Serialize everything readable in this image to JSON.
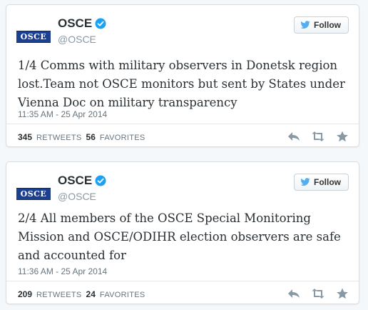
{
  "colors": {
    "verified": "#1da1f2",
    "logo_blue": "#1c3f8f",
    "text": "#292f33",
    "muted": "#8899a6"
  },
  "tweets": [
    {
      "avatar_text": "OSCE",
      "display_name": "OSCE",
      "handle": "@OSCE",
      "follow_label": "Follow",
      "text": "1/4 Comms with military observers in Donetsk region lost.Team not OSCE monitors but sent by States under Vienna Doc on military transparency",
      "timestamp": "11:35 AM - 25 Apr 2014",
      "retweet_count": "345",
      "retweet_label": "RETWEETS",
      "favorite_count": "56",
      "favorite_label": "FAVORITES",
      "icons": [
        "verified-icon",
        "bird-icon",
        "reply-icon",
        "retweet-icon",
        "favorite-icon"
      ]
    },
    {
      "avatar_text": "OSCE",
      "display_name": "OSCE",
      "handle": "@OSCE",
      "follow_label": "Follow",
      "text": "2/4 All members of the OSCE Special Monitoring Mission and OSCE/ODIHR election observers are safe and accounted for",
      "timestamp": "11:36 AM - 25 Apr 2014",
      "retweet_count": "209",
      "retweet_label": "RETWEETS",
      "favorite_count": "24",
      "favorite_label": "FAVORITES",
      "icons": [
        "verified-icon",
        "bird-icon",
        "reply-icon",
        "retweet-icon",
        "favorite-icon"
      ]
    }
  ]
}
